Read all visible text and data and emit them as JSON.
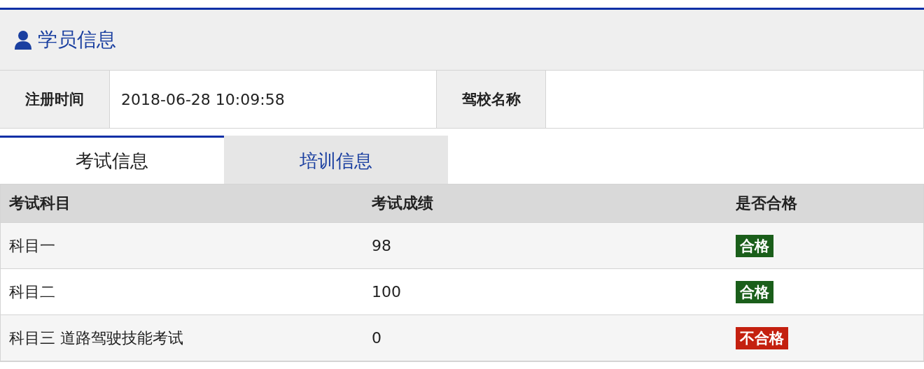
{
  "panel": {
    "title": "学员信息"
  },
  "info": [
    {
      "label": "注册时间",
      "value": "2018-06-28 10:09:58"
    },
    {
      "label": "驾校名称"
    }
  ],
  "tabs": [
    {
      "label": "考试信息",
      "selected": true
    },
    {
      "label": "培训信息",
      "selected": false
    }
  ],
  "table": {
    "columns": [
      "考试科目",
      "考试成绩",
      "是否合格"
    ],
    "rows": [
      {
        "subject": "科目一",
        "score": "98",
        "result": "合格",
        "passed": true
      },
      {
        "subject": "科目二",
        "score": "100",
        "result": "合格",
        "passed": true
      },
      {
        "subject": "科目三 道路驾驶技能考试",
        "score": "0",
        "result": "不合格",
        "passed": false
      }
    ]
  }
}
